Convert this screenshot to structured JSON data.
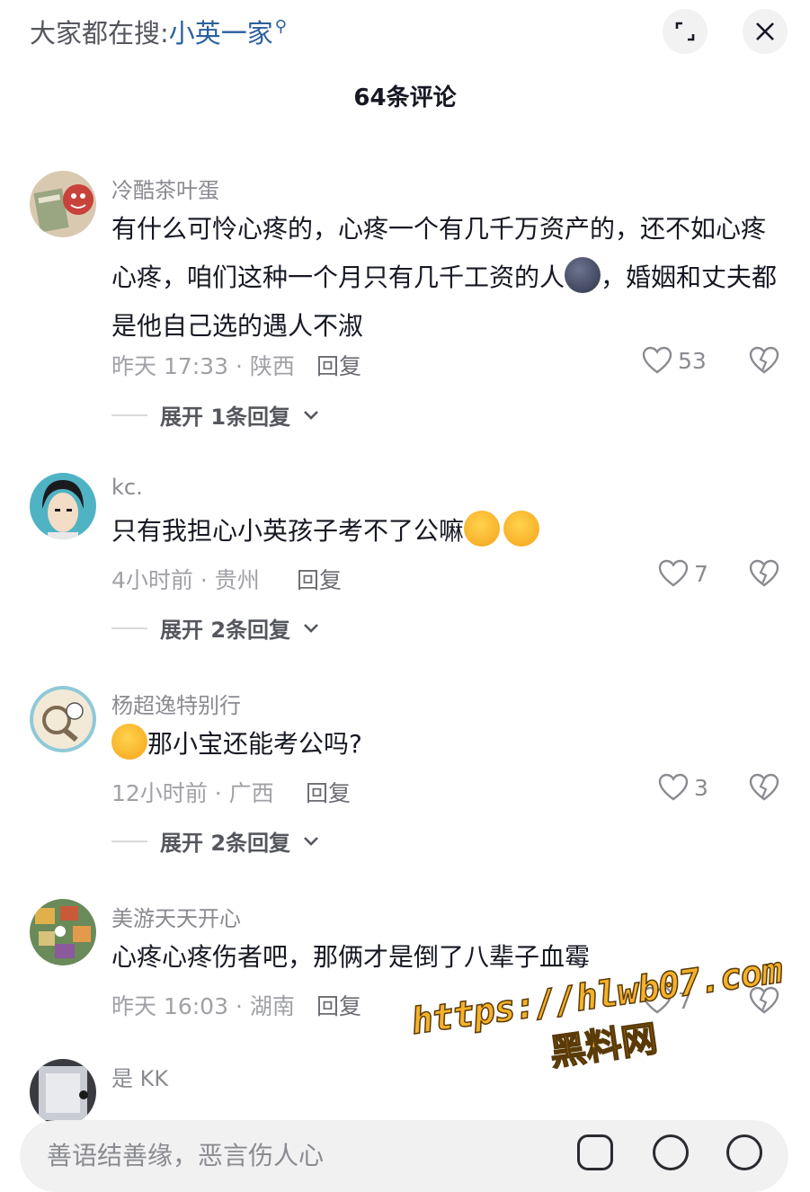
{
  "header": {
    "search_prefix": "大家都在搜:",
    "search_keyword": "小英一家",
    "comment_count": "64条评论"
  },
  "comments": [
    {
      "username": "冷酷茶叶蛋",
      "text_part1": "有什么可怜心疼的，心疼一个有几千万资产的，还不如心疼心疼，咱们这种一个月只有几千工资的人",
      "text_part2": "，婚姻和丈夫都是他自己选的遇人不淑",
      "time_location": "昨天 17:33 · 陕西",
      "reply_label": "回复",
      "likes": "53",
      "expand_label": "展开 1条回复"
    },
    {
      "username": "kc.",
      "text": "只有我担心小英孩子考不了公嘛",
      "time_location": "4小时前 · 贵州",
      "reply_label": "回复",
      "likes": "7",
      "expand_label": "展开 2条回复"
    },
    {
      "username": "杨超逸特别行",
      "text": "那小宝还能考公吗?",
      "time_location": "12小时前 · 广西",
      "reply_label": "回复",
      "likes": "3",
      "expand_label": "展开 2条回复"
    },
    {
      "username": "美游天天开心",
      "text": "心疼心疼伤者吧，那俩才是倒了八辈子血霉",
      "time_location": "昨天 16:03 · 湖南",
      "reply_label": "回复",
      "likes": "7"
    },
    {
      "username": "是 KK"
    }
  ],
  "watermark": {
    "url": "https://hlwb07.com",
    "name": "黑料网"
  },
  "input": {
    "placeholder": "善语结善缘，恶言伤人心"
  }
}
